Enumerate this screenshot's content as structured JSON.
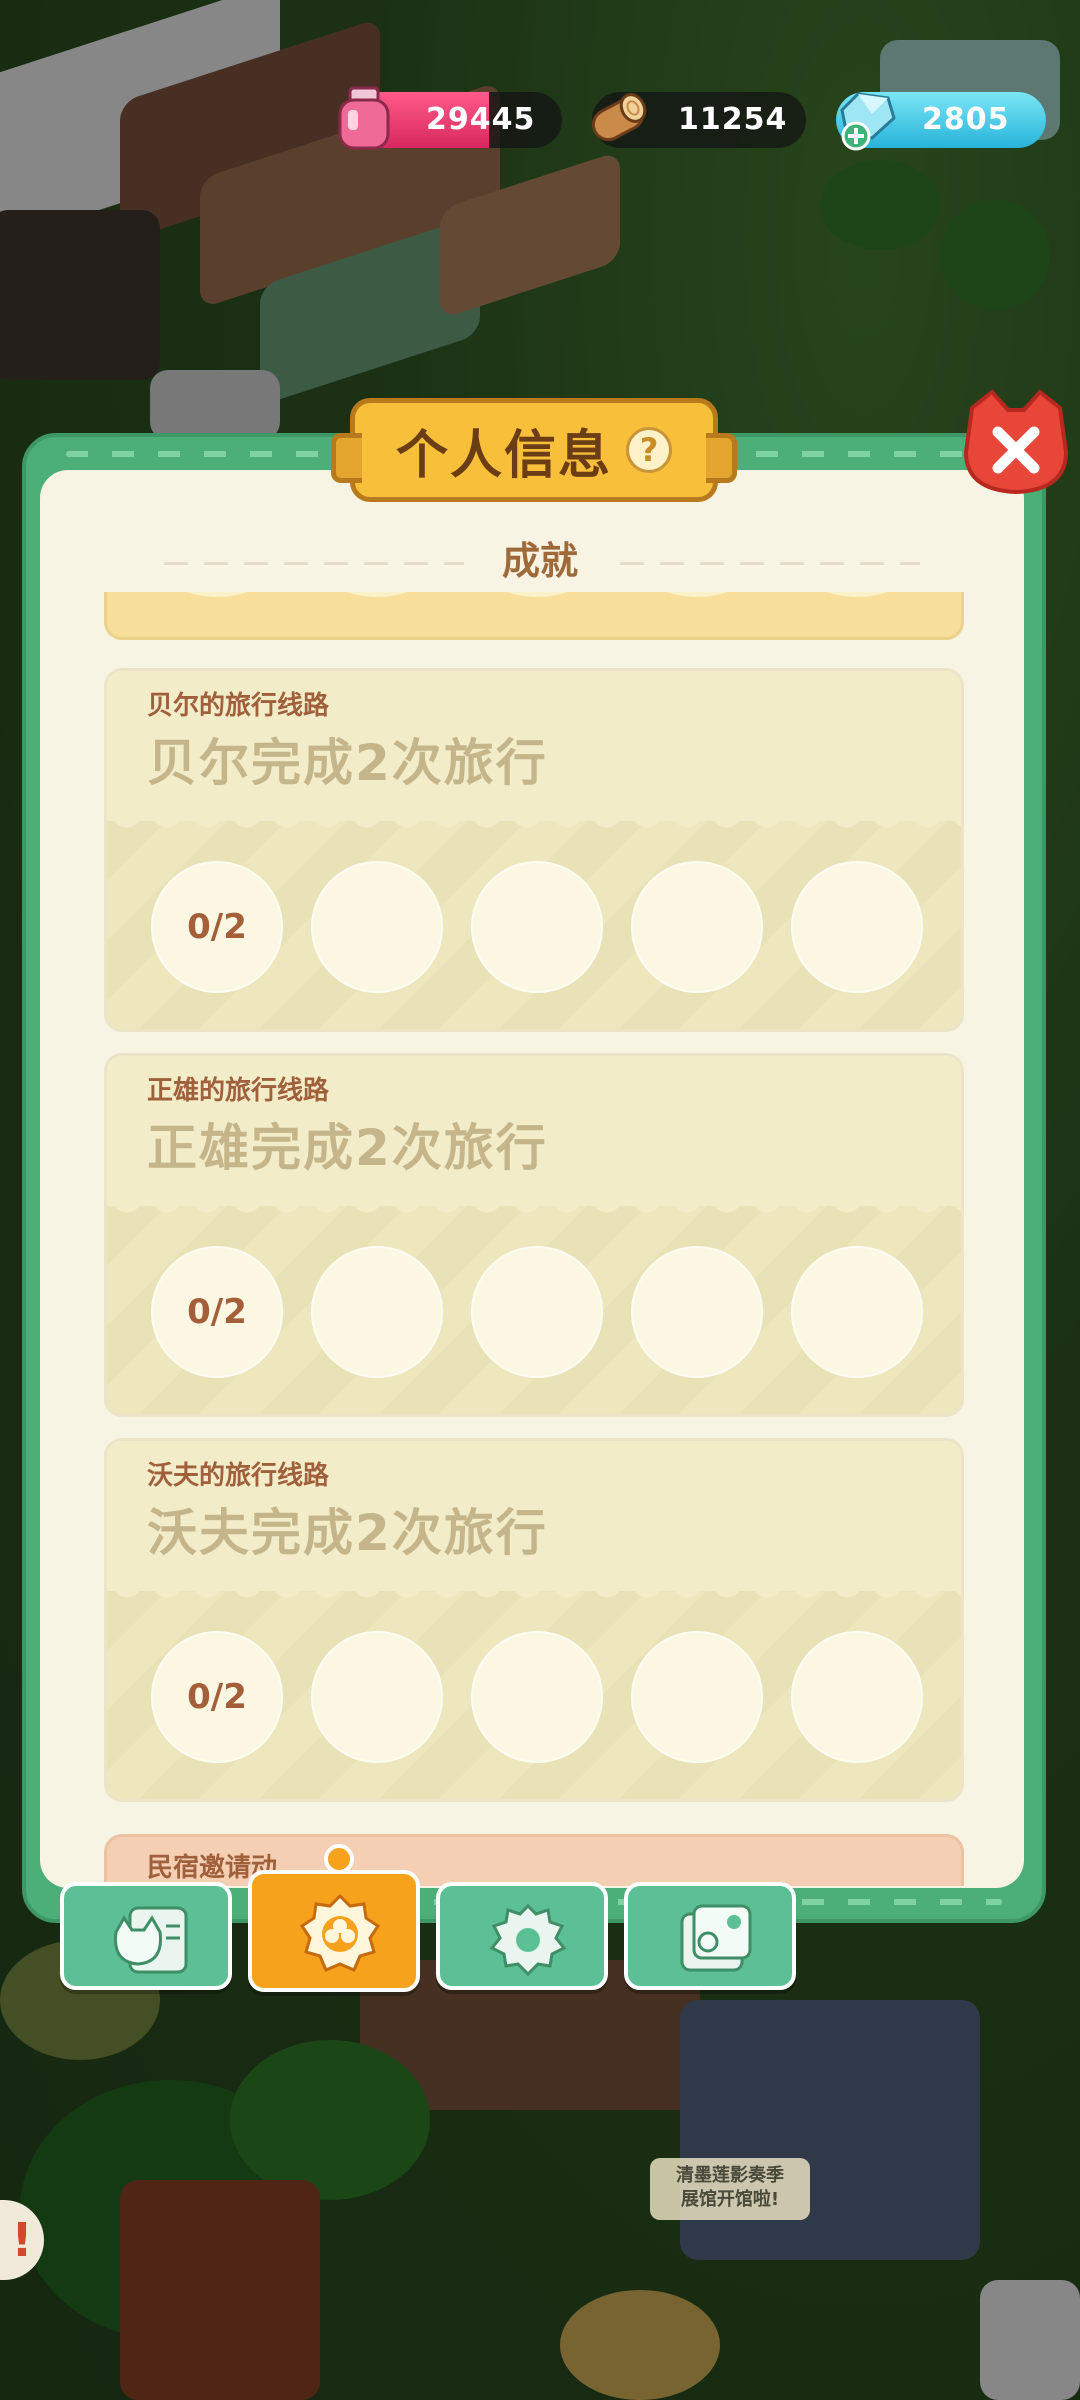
{
  "resources": {
    "ink": {
      "value": "29445",
      "icon": "ink-bottle-icon",
      "fill_fraction": 0.67,
      "color": "#e8346c"
    },
    "wood": {
      "value": "11254",
      "icon": "wood-log-icon"
    },
    "gems": {
      "value": "2805",
      "icon": "gem-add-icon",
      "color": "#4ccbe8"
    }
  },
  "panel": {
    "title": "个人信息",
    "help": "?",
    "section": "成就",
    "accent": "#4caf78",
    "title_color": "#f7bf3a"
  },
  "achievements": [
    {
      "subtitle": "贝尔的旅行线路",
      "title": "贝尔完成2次旅行",
      "progress": "0/2"
    },
    {
      "subtitle": "正雄的旅行线路",
      "title": "正雄完成2次旅行",
      "progress": "0/2"
    },
    {
      "subtitle": "沃夫的旅行线路",
      "title": "沃夫完成2次旅行",
      "progress": "0/2"
    }
  ],
  "partial_next": {
    "subtitle": "民宿邀请动",
    "title": ""
  },
  "tabs": [
    {
      "name": "profile-card",
      "icon": "cat-card-icon",
      "active": false
    },
    {
      "name": "achievements",
      "icon": "medal-icon",
      "active": true
    },
    {
      "name": "settings",
      "icon": "gear-icon",
      "active": false
    },
    {
      "name": "album",
      "icon": "photo-album-icon",
      "active": false
    }
  ],
  "scene": {
    "sign_line1": "清墨莲影奏季",
    "sign_line2": "展馆开馆啦!",
    "alert": "!"
  }
}
